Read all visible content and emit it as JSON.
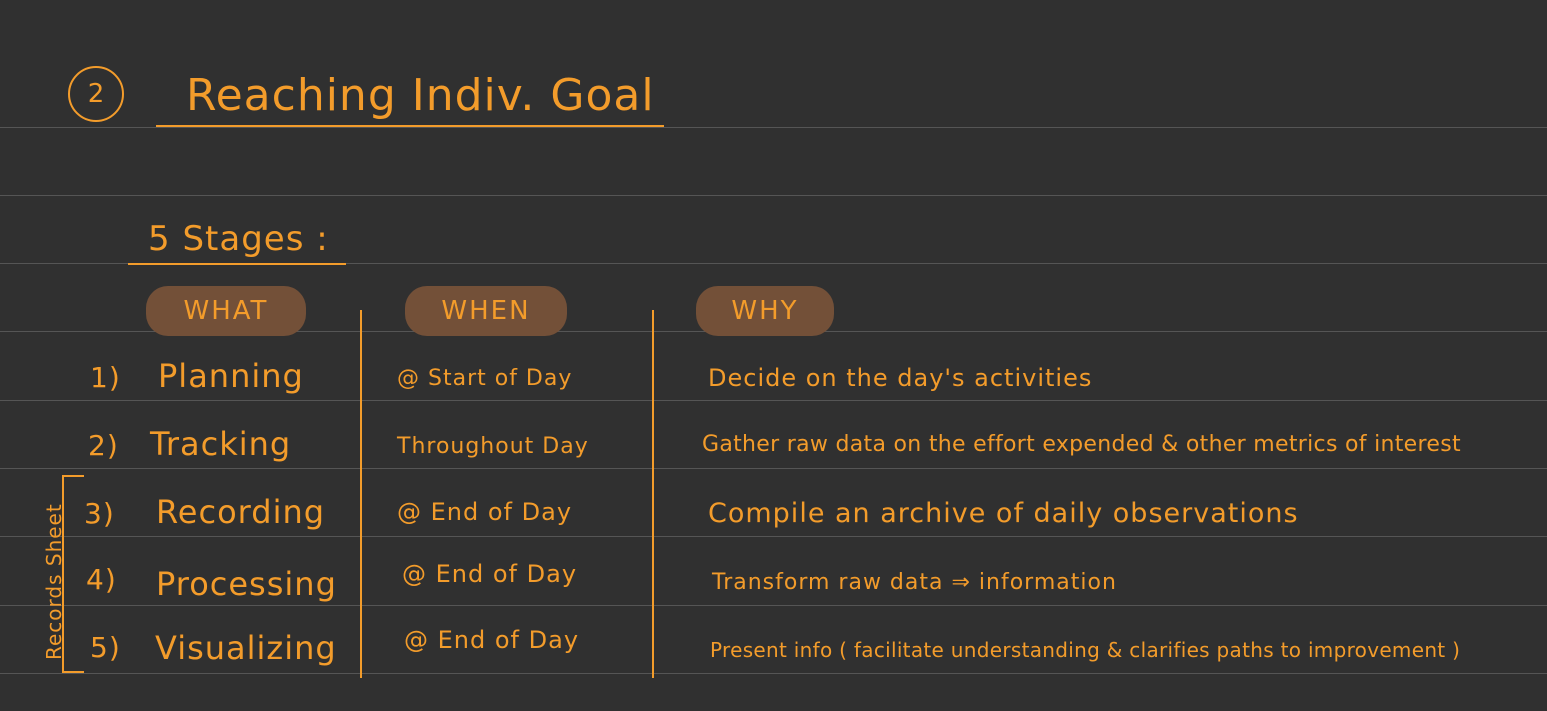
{
  "colors": {
    "background": "#303030",
    "ink": "#f39c2b",
    "header_pill": "#735038",
    "rule_line": "#555555"
  },
  "section": {
    "number": "2",
    "title": "Reaching Indiv. Goal"
  },
  "stages_heading": "5 Stages :",
  "headers": {
    "what": "WHAT",
    "when": "WHEN",
    "why": "WHY"
  },
  "rows": [
    {
      "num": "1)",
      "what": "Planning",
      "when": "@ Start of Day",
      "why": "Decide on the day's activities"
    },
    {
      "num": "2)",
      "what": "Tracking",
      "when": "Throughout Day",
      "why": "Gather raw data on the effort expended & other metrics of interest"
    },
    {
      "num": "3)",
      "what": "Recording",
      "when": "@ End of Day",
      "why": "Compile an archive of daily observations"
    },
    {
      "num": "4)",
      "what": "Processing",
      "when": "@ End of Day",
      "why": "Transform raw data ⇒ information"
    },
    {
      "num": "5)",
      "what": "Visualizing",
      "when": "@ End of Day",
      "why": "Present info ( facilitate understanding & clarifies paths to improvement )"
    }
  ],
  "bracket_label": "Records Sheet"
}
